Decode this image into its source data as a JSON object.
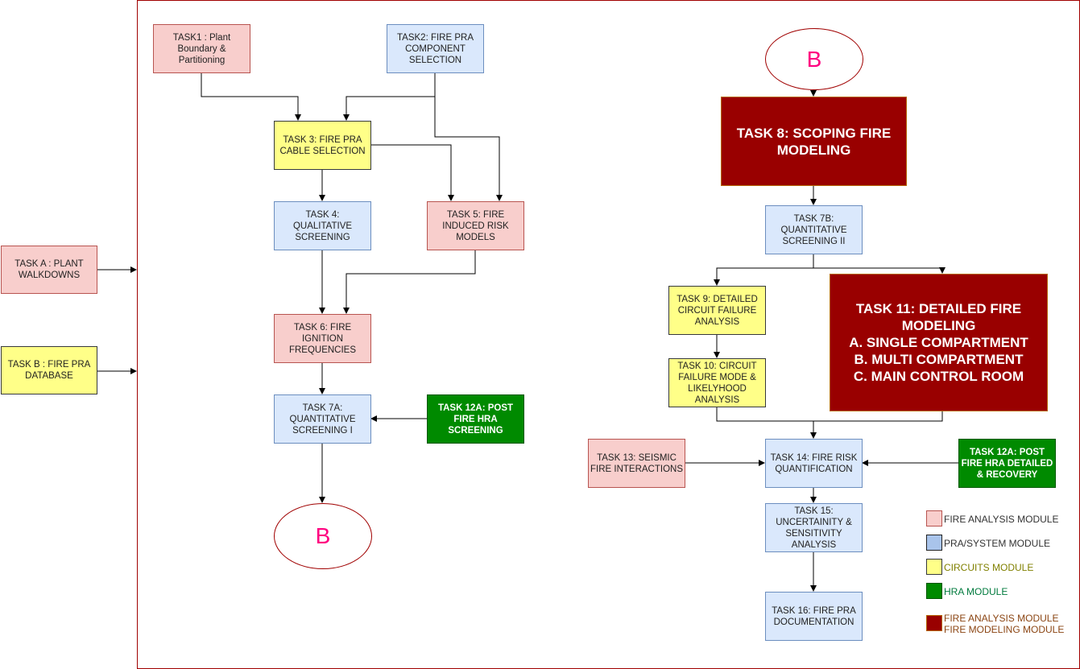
{
  "nodes": {
    "taskA": "TASK A : PLANT WALKDOWNS",
    "taskB": "TASK B : FIRE PRA DATABASE",
    "task1": "TASK1 : Plant Boundary & Partitioning",
    "task2": "TASK2: FIRE PRA COMPONENT SELECTION",
    "task3": "TASK 3: FIRE PRA CABLE SELECTION",
    "task4": "TASK 4: QUALITATIVE SCREENING",
    "task5": "TASK 5: FIRE INDUCED RISK MODELS",
    "task6": "TASK 6: FIRE IGNITION FREQUENCIES",
    "task7a": "TASK 7A: QUANTITATIVE SCREENING I",
    "task12a": "TASK 12A: POST FIRE HRA SCREENING",
    "b_left": "B",
    "b_right": "B",
    "task8": "TASK 8: SCOPING FIRE MODELING",
    "task7b": "TASK 7B: QUANTITATIVE SCREENING II",
    "task9": "TASK 9: DETAILED CIRCUIT FAILURE ANALYSIS",
    "task10": "TASK 10: CIRCUIT FAILURE MODE & LIKELYHOOD ANALYSIS",
    "task11": "TASK 11: DETAILED FIRE MODELING\nA. SINGLE COMPARTMENT\nB. MULTI COMPARTMENT\nC. MAIN CONTROL ROOM",
    "task13": "TASK 13: SEISMIC FIRE INTERACTIONS",
    "task14": "TASK 14: FIRE RISK QUANTIFICATION",
    "task12a_right": "TASK 12A: POST FIRE HRA DETAILED & RECOVERY",
    "task15": "TASK 15: UNCERTAINITY & SENSITIVITY ANALYSIS",
    "task16": "TASK 16: FIRE PRA DOCUMENTATION"
  },
  "legend": [
    {
      "label": "FIRE ANALYSIS MODULE",
      "color": "#f8cecc",
      "text_color": "#333333"
    },
    {
      "label": "PRA/SYSTEM MODULE",
      "color": "#a9c4eb",
      "text_color": "#333333"
    },
    {
      "label": "CIRCUITS MODULE",
      "color": "#ffff88",
      "text_color": "#808000"
    },
    {
      "label": "HRA MODULE",
      "color": "#008a00",
      "text_color": "#007a3d"
    },
    {
      "label": "FIRE ANALYSIS MODULE\nFIRE MODELING MODULE",
      "color": "#990000",
      "text_color": "#8b4513"
    }
  ]
}
